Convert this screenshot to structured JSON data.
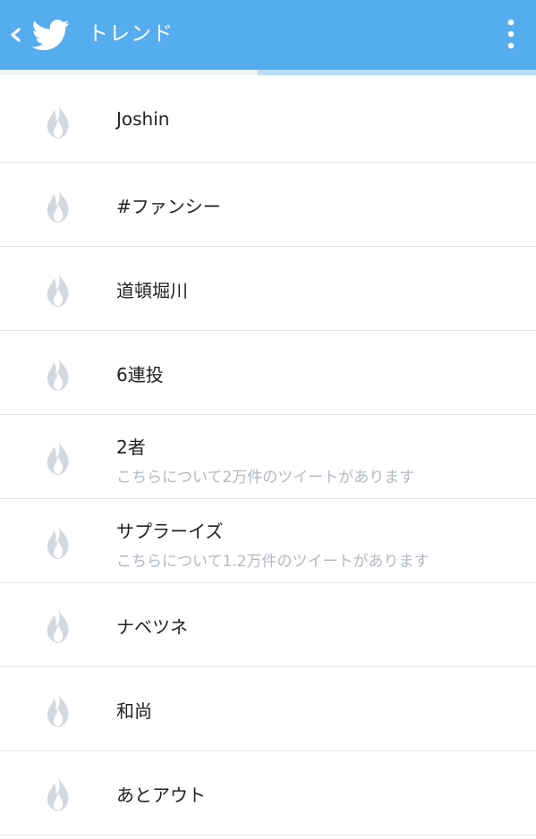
{
  "appbar": {
    "title": "トレンド",
    "color": "#55acee",
    "back_icon": "chevron-left-icon",
    "logo_icon": "twitter-bird-icon",
    "menu_icon": "overflow-menu-icon"
  },
  "loading_progress": 0.48,
  "trends": [
    {
      "name": "Joshin",
      "meta": ""
    },
    {
      "name": "#ファンシー",
      "meta": ""
    },
    {
      "name": "道頓堀川",
      "meta": ""
    },
    {
      "name": "6連投",
      "meta": ""
    },
    {
      "name": "2者",
      "meta": "こちらについて2万件のツイートがあります"
    },
    {
      "name": "サプラーイズ",
      "meta": "こちらについて1.2万件のツイートがあります"
    },
    {
      "name": "ナベツネ",
      "meta": ""
    },
    {
      "name": "和尚",
      "meta": ""
    },
    {
      "name": "あとアウト",
      "meta": ""
    }
  ],
  "trend_icon": "flame-icon"
}
